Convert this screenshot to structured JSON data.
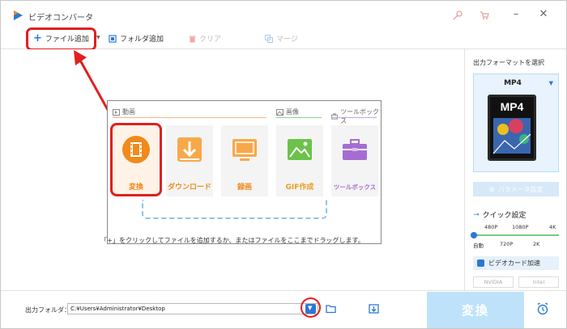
{
  "app": {
    "title": "ビデオコンバータ"
  },
  "toolbar": {
    "add_file": "ファイル追加",
    "add_folder": "フォルダ追加",
    "clear": "クリア",
    "merge": "マージ"
  },
  "modules": {
    "categories": {
      "video": "動画",
      "image": "画像",
      "toolbox": "ツールボックス"
    },
    "tiles": [
      {
        "label": "変換",
        "icon": "film-icon"
      },
      {
        "label": "ダウンロード",
        "icon": "download-icon"
      },
      {
        "label": "録画",
        "icon": "screen-record-icon"
      },
      {
        "label": "GIF作成",
        "icon": "image-icon"
      },
      {
        "label": "ツールボックス",
        "icon": "toolbox-icon"
      }
    ]
  },
  "hint": "「+」をクリックしてファイルを追加するか、またはファイルをここまでドラッグします。",
  "right_panel": {
    "title": "出力フォーマットを選択",
    "format": "MP4",
    "format_thumb": "MP4",
    "param_button": "パラメータ設定",
    "quick_settings": "クイック設定",
    "quality_top": [
      "480P",
      "1080P",
      "4K"
    ],
    "quality_bottom": [
      "自動",
      "720P",
      "2K"
    ],
    "gpu_accel": "ビデオカード加速",
    "vendors": [
      "NVIDIA",
      "Intel"
    ]
  },
  "bottom": {
    "output_label": "出力フォルダ：",
    "output_path": "C:¥Users¥Administrator¥Desktop",
    "convert_button": "変換"
  },
  "colors": {
    "accent_blue": "#2b78d4",
    "orange": "#f08a1c",
    "annotation_red": "#e02020",
    "convert_disabled": "#bfe2fb"
  }
}
